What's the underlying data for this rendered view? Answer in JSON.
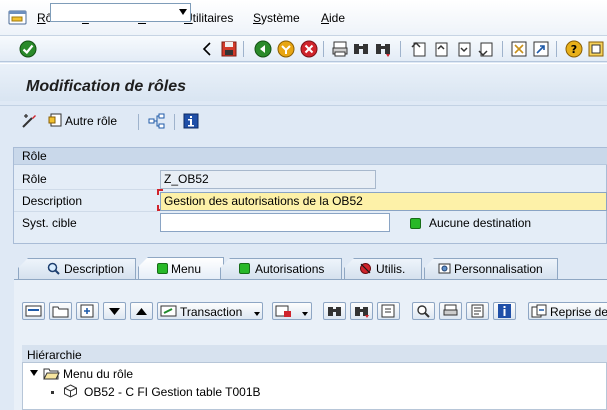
{
  "menu": {
    "items": [
      {
        "key": "R",
        "rest": "ôle"
      },
      {
        "key": "T",
        "rest": "raiter"
      },
      {
        "key": "S",
        "rest": "aut"
      },
      {
        "key": "U",
        "rest": "tilitaires"
      },
      {
        "key": "S",
        "rest": "ystème"
      },
      {
        "key": "A",
        "rest": "ide"
      }
    ]
  },
  "toolbar": {
    "command_value": ""
  },
  "header": {
    "title": "Modification de rôles"
  },
  "app_toolbar": {
    "other_role_label": "Autre rôle"
  },
  "role_group": {
    "title": "Rôle",
    "role_label": "Rôle",
    "role_value": "Z_OB52",
    "description_label": "Description",
    "description_value": "Gestion des autorisations de la OB52",
    "target_label": "Syst. cible",
    "target_value": "",
    "destination_status": "Aucune destination"
  },
  "tabs": [
    {
      "label": "Description"
    },
    {
      "label": "Menu"
    },
    {
      "label": "Autorisations"
    },
    {
      "label": "Utilis."
    },
    {
      "label": "Personnalisation"
    }
  ],
  "menu_toolbar": {
    "transaction_label": "Transaction",
    "reprise_label": "Reprise de"
  },
  "tree": {
    "header": "Hiérarchie",
    "root_label": "Menu du rôle",
    "child_label": "OB52 - C FI Gestion table T001B"
  },
  "colors": {
    "status_green": "#28b828",
    "status_red": "#d0242c",
    "field_focus": "#fdf1a8"
  }
}
